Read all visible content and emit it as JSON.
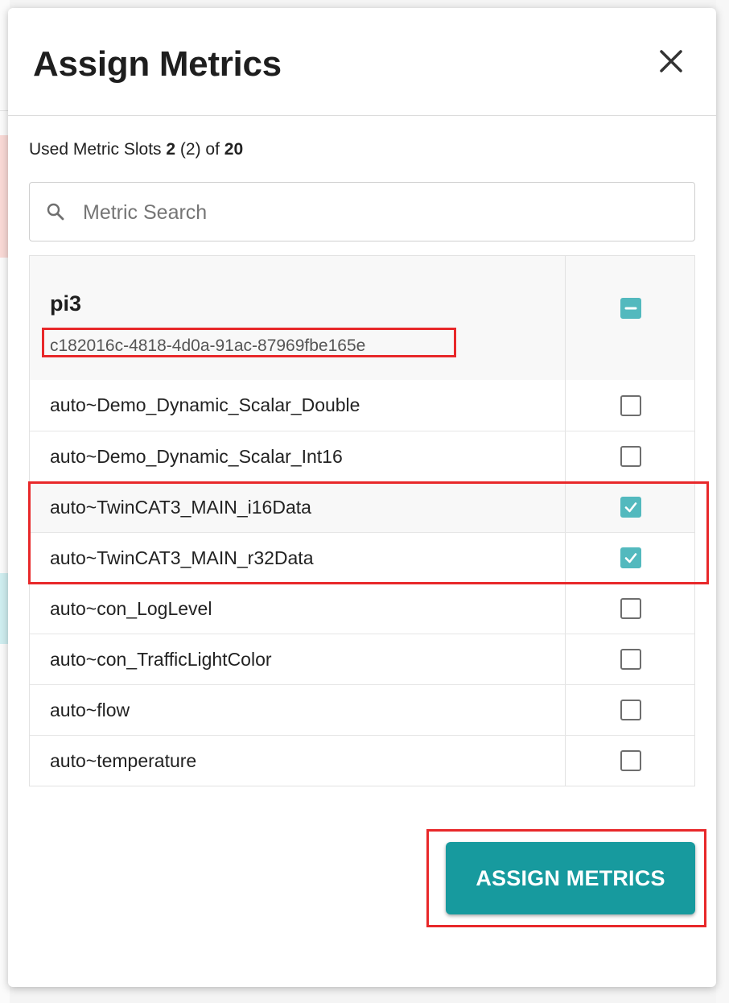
{
  "dialog": {
    "title": "Assign Metrics",
    "close_icon": "close-icon"
  },
  "slots": {
    "prefix": "Used Metric Slots ",
    "used": "2",
    "pending": " (2) of ",
    "total": "20"
  },
  "search": {
    "icon": "search-icon",
    "placeholder": "Metric Search",
    "value": ""
  },
  "group": {
    "name": "pi3",
    "id": "c182016c-4818-4d0a-91ac-87969fbe165e",
    "checkbox_state": "indeterminate"
  },
  "metrics": [
    {
      "name": "auto~Demo_Dynamic_Scalar_Double",
      "checked": false
    },
    {
      "name": "auto~Demo_Dynamic_Scalar_Int16",
      "checked": false
    },
    {
      "name": "auto~TwinCAT3_MAIN_i16Data",
      "checked": true
    },
    {
      "name": "auto~TwinCAT3_MAIN_r32Data",
      "checked": true
    },
    {
      "name": "auto~con_LogLevel",
      "checked": false
    },
    {
      "name": "auto~con_TrafficLightColor",
      "checked": false
    },
    {
      "name": "auto~flow",
      "checked": false
    },
    {
      "name": "auto~temperature",
      "checked": false
    }
  ],
  "actions": {
    "assign_label": "ASSIGN METRICS"
  },
  "colors": {
    "accent": "#179a9e",
    "checkbox_checked": "#53b9be",
    "highlight": "#e8282a"
  }
}
